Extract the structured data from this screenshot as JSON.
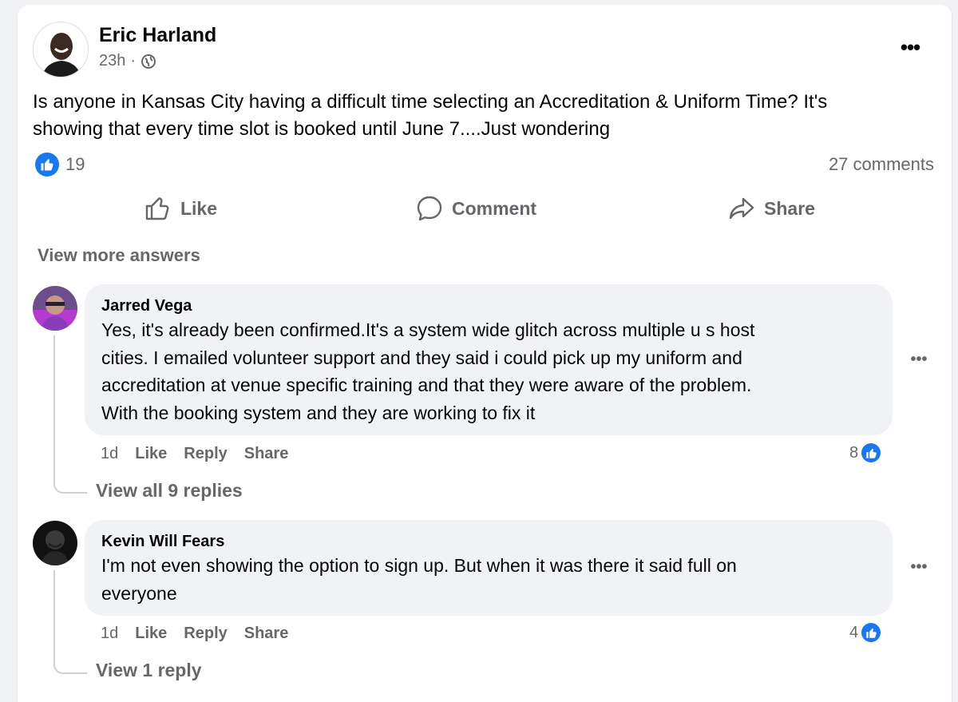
{
  "post": {
    "author": "Eric Harland",
    "time": "23h",
    "separator": "·",
    "text_line1": "Is anyone in Kansas City having a difficult time selecting an Accreditation & Uniform Time?  It's",
    "text_line2": "showing that every time slot is booked until June 7....Just wondering",
    "reaction_count": "19",
    "comments_count": "27 comments",
    "more_label": "•••"
  },
  "actions": {
    "like": "Like",
    "comment": "Comment",
    "share": "Share"
  },
  "view_more_answers": "View more answers",
  "comments": [
    {
      "name": "Jarred Vega",
      "lines": [
        "Yes, it's already been confirmed.It's a system wide glitch across multiple u s host",
        "cities. I emailed volunteer support and they said i could pick up my uniform and",
        "accreditation at venue specific training and that they were aware of the problem.",
        "With the booking system and they are working to fix it"
      ],
      "time": "1d",
      "like": "Like",
      "reply": "Reply",
      "share": "Share",
      "likes": "8",
      "more": "•••",
      "view_replies": "View all 9 replies"
    },
    {
      "name": "Kevin Will Fears",
      "lines": [
        "I'm not even showing the option to sign up. But when it was there it said full on",
        "everyone"
      ],
      "time": "1d",
      "like": "Like",
      "reply": "Reply",
      "share": "Share",
      "likes": "4",
      "more": "•••",
      "view_replies": "View 1 reply"
    }
  ],
  "colors": {
    "accent": "#1877f2",
    "secondary_text": "#65676b",
    "bubble": "#f0f2f5"
  },
  "icons": {
    "avatar_post": "avatar",
    "globe": "globe-icon",
    "thumb": "thumbs-up-icon",
    "comment": "comment-bubble-icon",
    "share": "share-arrow-icon"
  }
}
